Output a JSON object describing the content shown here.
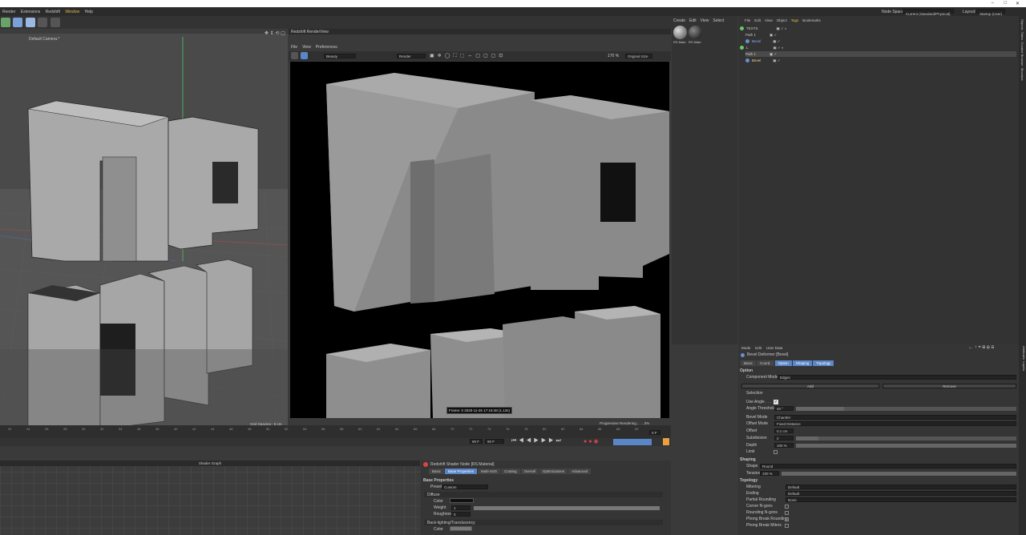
{
  "titlebar": {
    "controls": [
      "–",
      "□",
      "✕"
    ]
  },
  "menubar": {
    "items": [
      "Render",
      "Extensions",
      "Redshift",
      "Window",
      "Help"
    ],
    "node_space_label": "Node Space:",
    "node_space_value": "Current (Standard/Physical)",
    "layout_label": "Layout:",
    "layout_value": "Startup (User)"
  },
  "viewport": {
    "camera": "Default Camera.*",
    "grid": "Grid Spacing : 5 cm"
  },
  "renderview": {
    "title": "Redshift RenderView",
    "menus": [
      "File",
      "View",
      "Preferences"
    ],
    "beauty": "Beauty",
    "render": "Render",
    "zoom": "170 %",
    "size": "Original Size",
    "frame_info": "Frame: 0   2020-11-25  17:19:48  (1.13s)",
    "progress": "Progressive Rendering...",
    "progress_pct": "...3%"
  },
  "material_manager": {
    "menus": [
      "Create",
      "Edit",
      "View",
      "Select"
    ],
    "materials": [
      "RS Mate",
      "RS Mate"
    ]
  },
  "object_manager": {
    "menus": [
      "File",
      "Edit",
      "View",
      "Object",
      "Tags",
      "Bookmarks"
    ],
    "objects": [
      {
        "name": "TEXTS",
        "depth": 0,
        "color": "#d9d9d9"
      },
      {
        "name": "Path 1",
        "depth": 1,
        "color": "#d9d9d9"
      },
      {
        "name": "Bevel",
        "depth": 1,
        "color": "#7fb0ff"
      },
      {
        "name": "L",
        "depth": 0,
        "color": "#d9d9d9"
      },
      {
        "name": "Path 1",
        "depth": 1,
        "color": "#d9d9d9"
      },
      {
        "name": "Bevel",
        "depth": 1,
        "color": "#ffd27f"
      }
    ]
  },
  "attributes": {
    "menus": [
      "Mode",
      "Edit",
      "User Data"
    ],
    "title": "Bevel Deformer [Bevel]",
    "tabs": [
      "Basic",
      "Coord.",
      "Option",
      "Shaping",
      "Topology"
    ],
    "option_label": "Option",
    "component_mode_label": "Component Mode",
    "component_mode": "Edges",
    "add": "Add",
    "remove": "Remove",
    "selection": "Selection",
    "use_angle": "Use Angle . . .",
    "angle_threshold_label": "Angle Threshold",
    "angle_threshold": "40 °",
    "bevel_mode_label": "Bevel Mode",
    "bevel_mode": "Chamfer",
    "offset_mode_label": "Offset Mode",
    "offset_mode": "Fixed Distance",
    "offset_label": "Offset",
    "offset": "0.1 cm",
    "subdivision_label": "Subdivision",
    "subdivision": "2",
    "depth_label": "Depth",
    "depth": "100 %",
    "limit": "Limit",
    "shaping_label": "Shaping",
    "shape_label": "Shape",
    "shape": "Round",
    "tension_label": "Tension",
    "tension": "100 %",
    "topology_label": "Topology",
    "mitering_label": "Mitering",
    "mitering": "Default",
    "ending_label": "Ending",
    "ending": "Default",
    "partial_label": "Partial Rounding",
    "partial": "None",
    "corner_ngons": "Corner N-gons",
    "rounding_ngons": "Rounding N-gons",
    "phong_rounding": "Phong Break Rounding",
    "phong_miters": "Phong Break Miters"
  },
  "timeline": {
    "ticks": [
      "22",
      "24",
      "26",
      "28",
      "30",
      "32",
      "34",
      "36",
      "38",
      "40",
      "42",
      "44",
      "46",
      "48",
      "50",
      "52",
      "54",
      "56",
      "58",
      "60",
      "62",
      "64",
      "66",
      "68",
      "70",
      "72",
      "74",
      "76",
      "78",
      "80",
      "82",
      "84",
      "86",
      "88",
      "90"
    ],
    "frame_start": "90 F",
    "frame_end": "90 F",
    "current": "0 F"
  },
  "shader_graph": {
    "title": "Shader Graph"
  },
  "shader_node": {
    "title": "Redshift Shader Node [RS Material]",
    "tabs": [
      "Basic",
      "Base Properties",
      "Multi-SSS",
      "Coating",
      "Overall",
      "Optimizations",
      "Advanced"
    ],
    "section": "Base Properties",
    "preset_label": "Preset",
    "preset": "Custom",
    "diffuse": "Diffuse",
    "color_label": "Color",
    "weight_label": "Weight",
    "weight": "1",
    "roughness_label": "Roughness",
    "roughness": "0",
    "backlight": "Back-lighting/Translucency",
    "bl_color_label": "Color"
  },
  "side_tabs": [
    "Objects",
    "Takes",
    "Content Browser",
    "Structure"
  ],
  "attr_side_tabs": [
    "Attributes",
    "Layers"
  ]
}
